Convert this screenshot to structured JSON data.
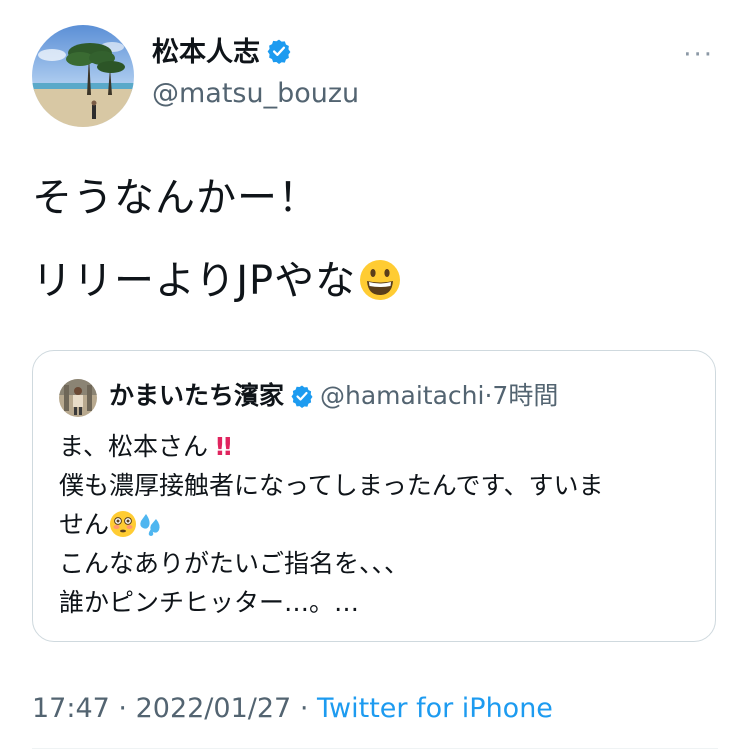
{
  "author": {
    "display_name": "松本人志",
    "handle": "@matsu_bouzu",
    "verified": true
  },
  "more_icon": "···",
  "tweet": {
    "line1": "そうなんかー！",
    "line2": "リリーよりJPやな"
  },
  "quoted_tweet": {
    "display_name": "かまいたち濱家",
    "handle": "@hamaitachi",
    "separator": "·",
    "time": "7時間",
    "lines": {
      "l1": "ま、松本さん",
      "l1_mark": "‼",
      "l2": "僕も濃厚接触者になってしまったんです、すいま",
      "l3": "せん",
      "l4": "こんなありがたいご指名を、、、",
      "l5": "誰かピンチヒッター…。…"
    }
  },
  "meta": {
    "time": "17:47",
    "separator": "·",
    "date": "2022/01/27",
    "source": "Twitter for iPhone"
  },
  "colors": {
    "link": "#1d9bf0",
    "secondary_text": "#536471",
    "border": "#cfd9de",
    "verified_badge": "#1d9bf0"
  }
}
